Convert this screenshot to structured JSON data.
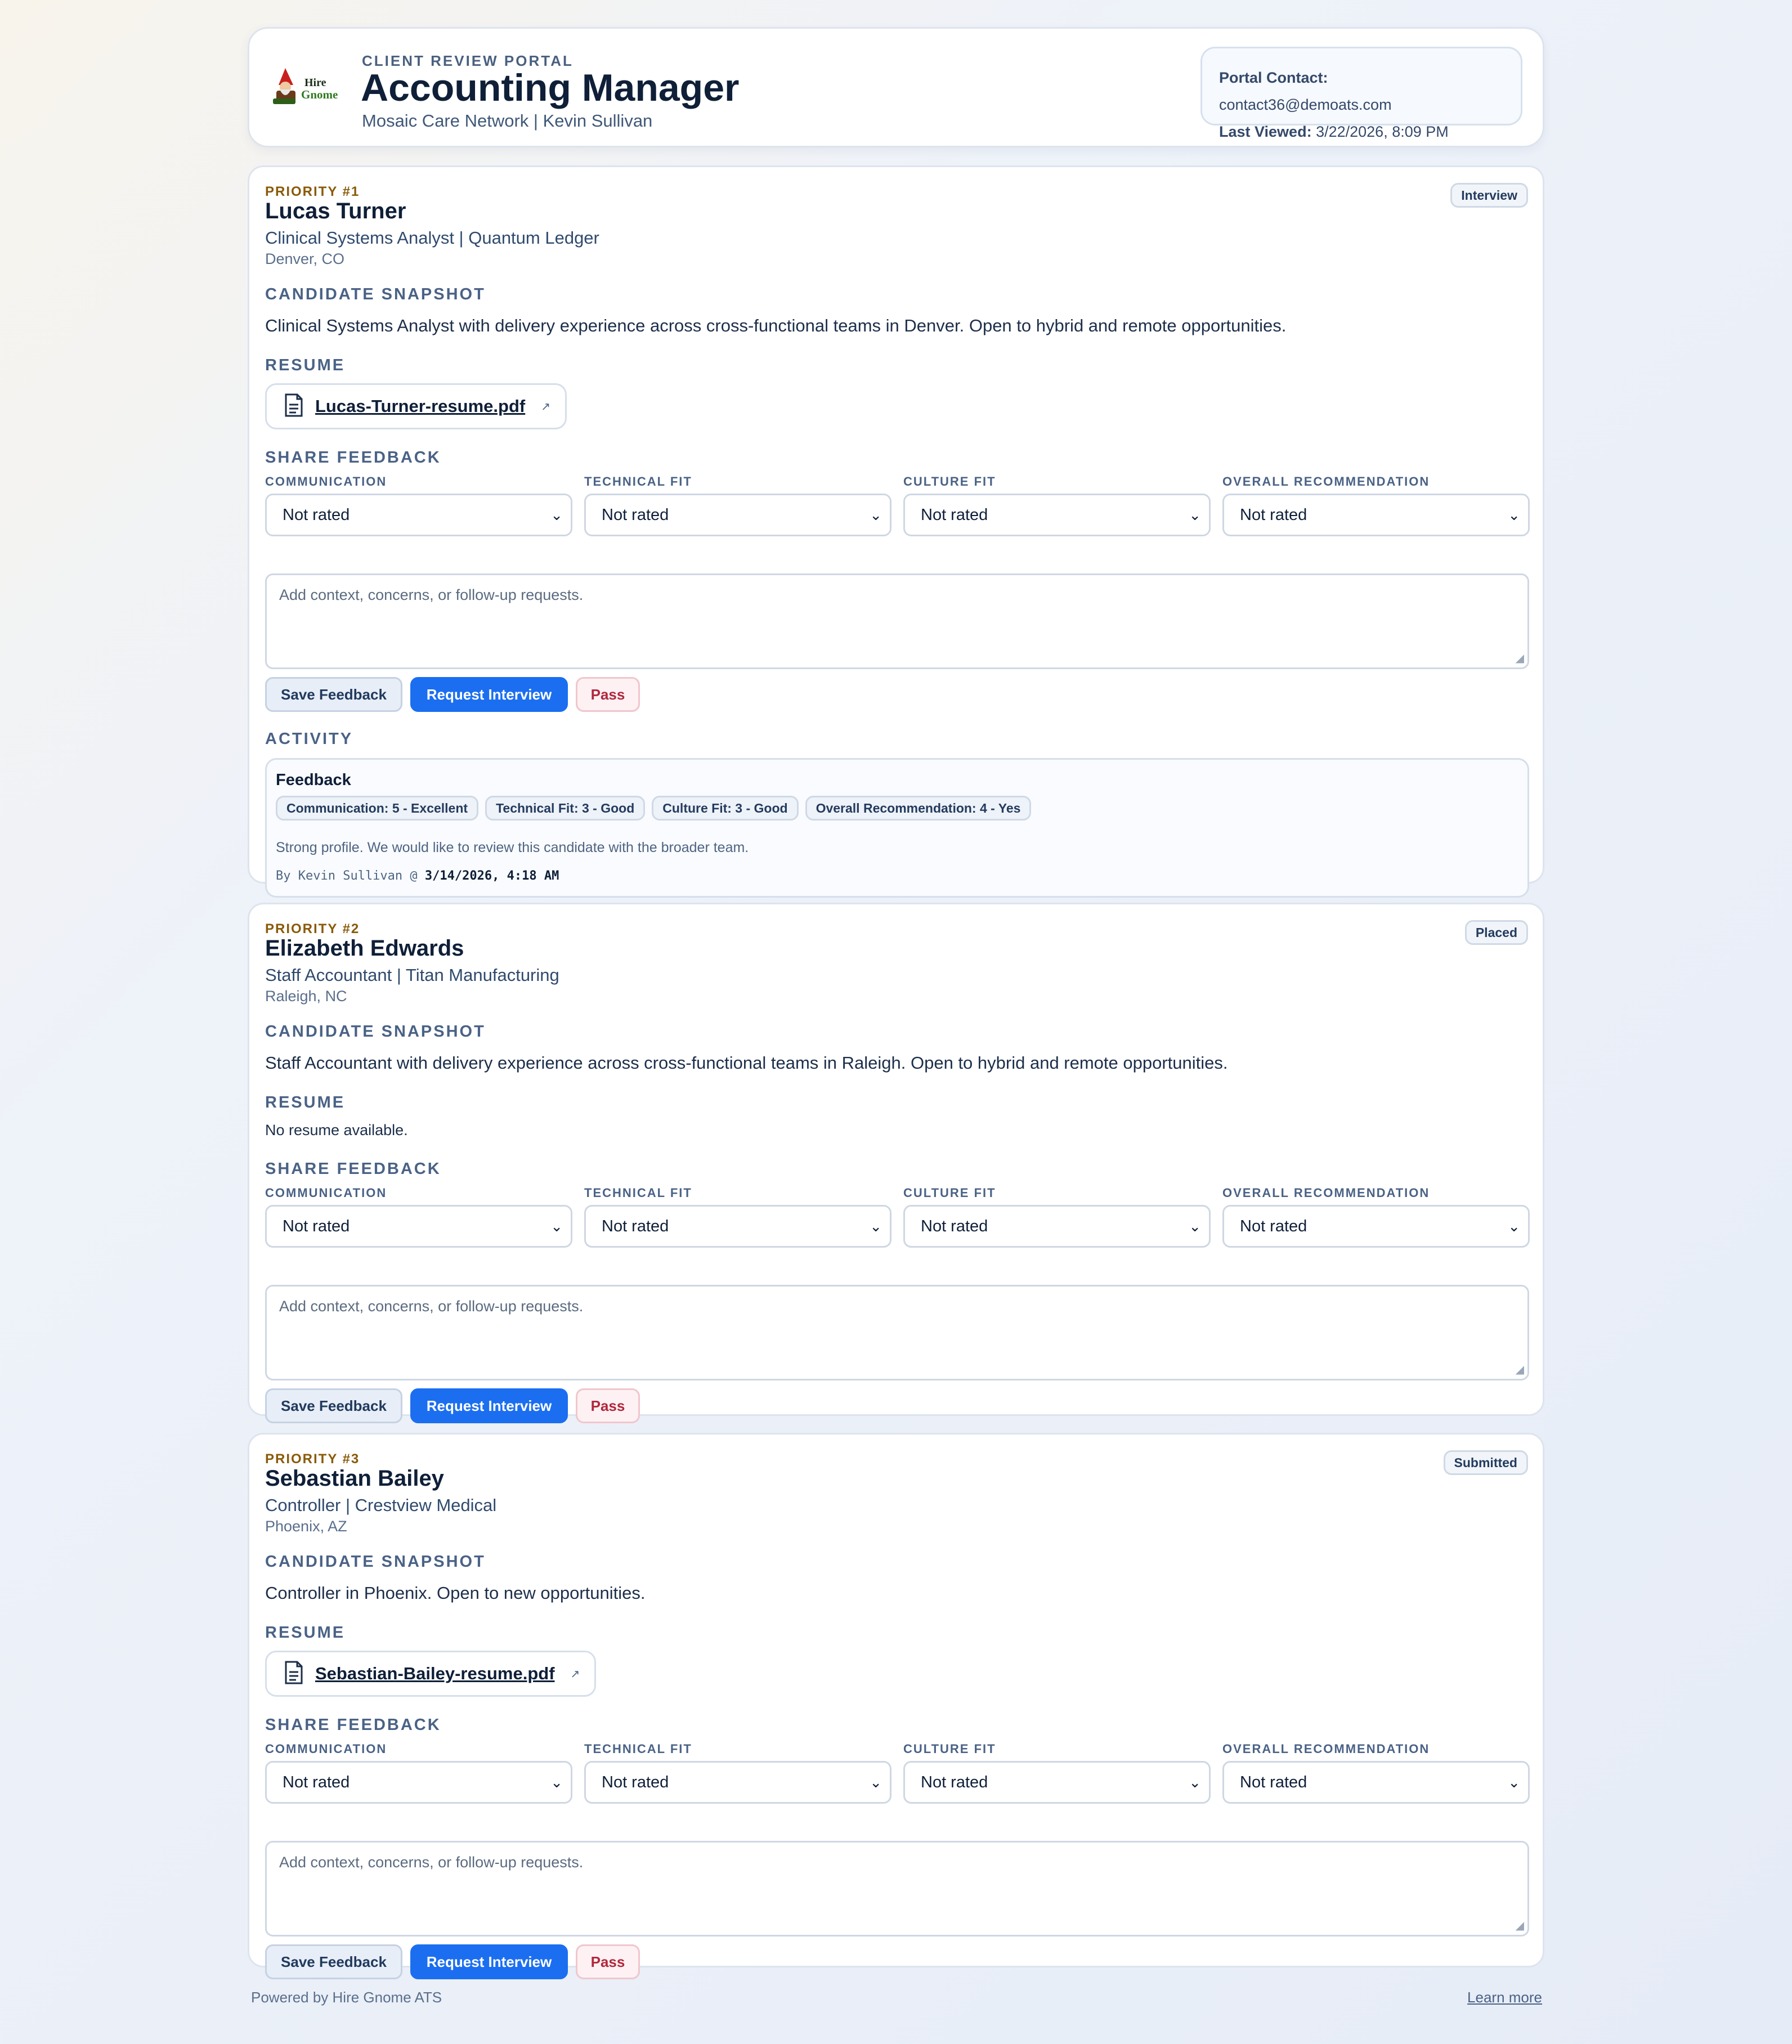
{
  "header": {
    "kicker": "CLIENT REVIEW PORTAL",
    "title": "Accounting Manager",
    "subtitle": "Mosaic Care Network | Kevin Sullivan",
    "logo_text_1": "Hire",
    "logo_text_2": "Gnome",
    "contact_label": "Portal Contact:",
    "contact_value": "contact36@demoats.com",
    "viewed_label": "Last Viewed:",
    "viewed_value": "3/22/2026, 8:09 PM"
  },
  "labels": {
    "snapshot": "CANDIDATE SNAPSHOT",
    "resume": "RESUME",
    "feedback": "SHARE FEEDBACK",
    "activity": "ACTIVITY",
    "communication": "COMMUNICATION",
    "technical": "TECHNICAL FIT",
    "culture": "CULTURE FIT",
    "overall": "OVERALL RECOMMENDATION",
    "not_rated": "Not rated",
    "notes_placeholder": "Add context, concerns, or follow-up requests.",
    "save": "Save Feedback",
    "request": "Request Interview",
    "pass": "Pass",
    "no_resume": "No resume available."
  },
  "candidates": [
    {
      "priority": "PRIORITY #1",
      "name": "Lucas Turner",
      "role": "Clinical Systems Analyst | Quantum Ledger",
      "location": "Denver, CO",
      "status": "Interview",
      "snapshot": "Clinical Systems Analyst with delivery experience across cross-functional teams in Denver. Open to hybrid and remote opportunities.",
      "resume_file": "Lucas-Turner-resume.pdf",
      "activity": {
        "heading": "Feedback",
        "chips": [
          "Communication: 5 - Excellent",
          "Technical Fit: 3 - Good",
          "Culture Fit: 3 - Good",
          "Overall Recommendation: 4 - Yes"
        ],
        "note": "Strong profile. We would like to review this candidate with the broader team.",
        "by_prefix": "By Kevin Sullivan @",
        "by_time": "3/14/2026, 4:18 AM"
      }
    },
    {
      "priority": "PRIORITY #2",
      "name": "Elizabeth Edwards",
      "role": "Staff Accountant | Titan Manufacturing",
      "location": "Raleigh, NC",
      "status": "Placed",
      "snapshot": "Staff Accountant with delivery experience across cross-functional teams in Raleigh. Open to hybrid and remote opportunities."
    },
    {
      "priority": "PRIORITY #3",
      "name": "Sebastian Bailey",
      "role": "Controller | Crestview Medical",
      "location": "Phoenix, AZ",
      "status": "Submitted",
      "snapshot": "Controller in Phoenix. Open to new opportunities.",
      "resume_file": "Sebastian-Bailey-resume.pdf"
    }
  ],
  "footer": {
    "powered": "Powered by Hire Gnome ATS",
    "learn": "Learn more"
  }
}
